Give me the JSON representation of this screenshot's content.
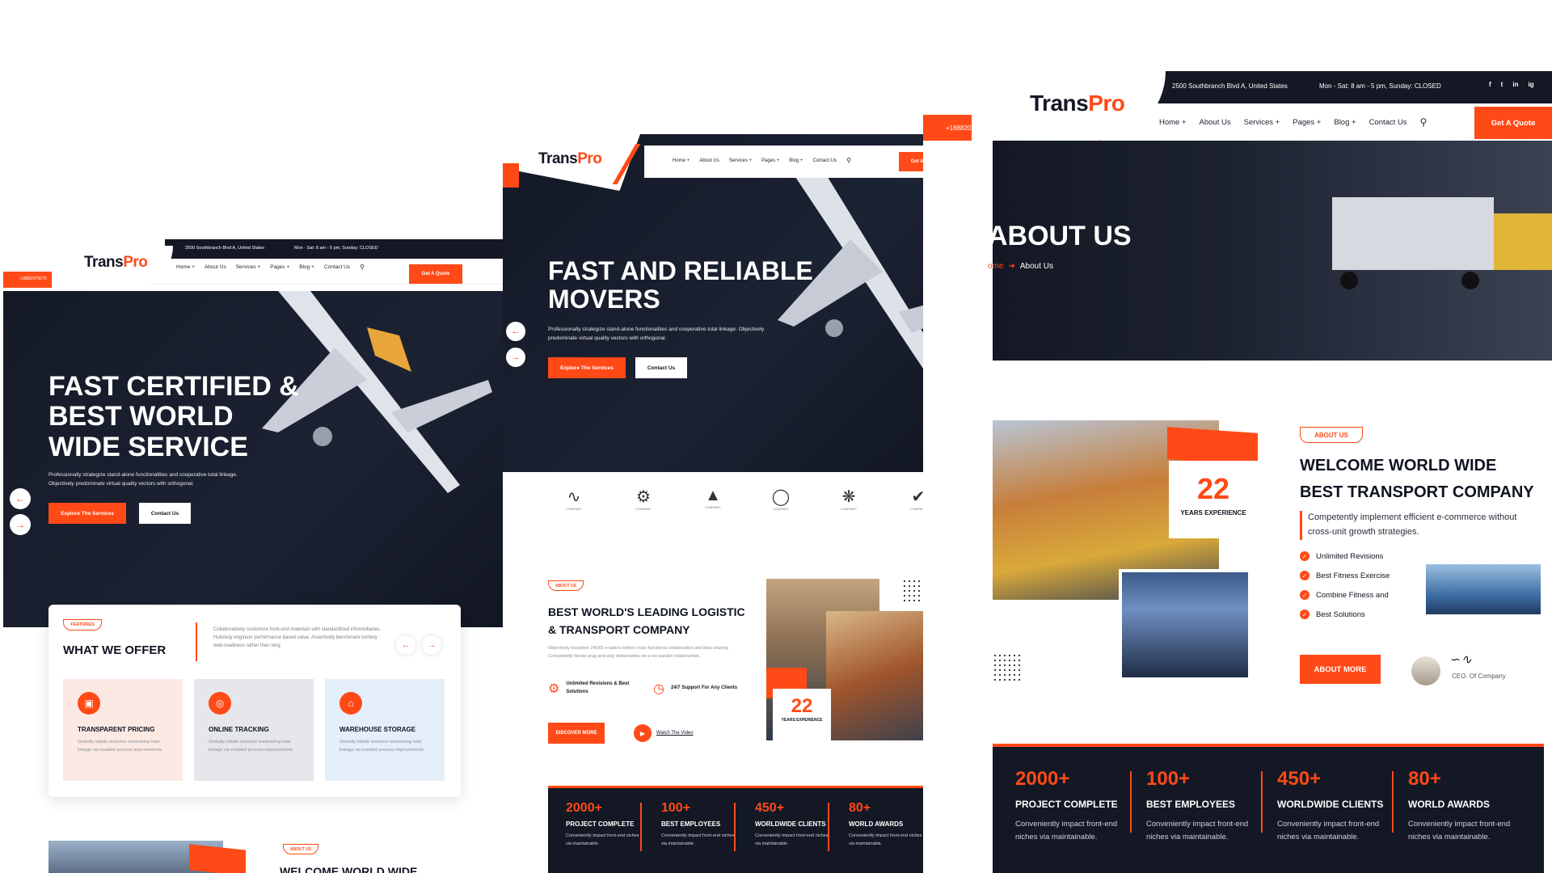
{
  "brand": {
    "logo_trans": "Trans",
    "logo_pro": "Pro",
    "accent": "#ff4a17",
    "dark": "#141824"
  },
  "topbar": {
    "address": "2500 Southbranch Blvd A, United States",
    "hours": "Mon - Sat: 8 am - 5 pm, Sunday: CLOSED",
    "phone": "+18882079275",
    "social": [
      "f",
      "t",
      "in",
      "ig"
    ]
  },
  "nav": {
    "items": [
      "Home +",
      "About Us",
      "Services +",
      "Pages +",
      "Blog +",
      "Contact Us"
    ],
    "quote": "Get A Quote"
  },
  "left": {
    "hero_title_1": "FAST CERTIFIED &",
    "hero_title_2": "BEST WORLD",
    "hero_title_3": "WIDE SERVICE",
    "hero_text_1": "Professionally strategize stand-alone functionalities and cooperative total linkage.",
    "hero_text_2": "Objectively predominate virtual quality vectors with orthogonal.",
    "explore": "Explore The Services",
    "contact": "Contact Us",
    "features_tag": "FEATURES",
    "offer_title": "WHAT WE OFFER",
    "offer_desc": "Collaboratively customize front-end materials with standardized infomediaries. Holisticly engineer performance based value. Assertively benchmark turnkey web-readiness rather than long",
    "cards": [
      {
        "title": "TRANSPARENT PRICING",
        "text": "Globally initiate resource maximizing total linkage via enabled process improvements."
      },
      {
        "title": "ONLINE TRACKING",
        "text": "Globally initiate resource maximizing total linkage via enabled process improvements."
      },
      {
        "title": "WAREHOUSE STORAGE",
        "text": "Globally initiate resource maximizing total linkage via enabled process improvements."
      }
    ],
    "about_tag": "ABOUT US",
    "welcome_partial": "WELCOME WORLD WIDE"
  },
  "middle": {
    "hero_title_1": "FAST AND RELIABLE",
    "hero_title_2": "MOVERS",
    "hero_text_1": "Professionally strategize stand-alone functionalities and cooperative total linkage. Objectively",
    "hero_text_2": "predominate virtual quality vectors with orthogonal.",
    "explore": "Explore The Services",
    "contact": "Contact Us",
    "partner_label": "COMPANY",
    "about_tag": "ABOUT US",
    "about_title_1": "BEST WORLD'S LEADING LOGISTIC",
    "about_title_2": "& TRANSPORT COMPANY",
    "about_text": "Objectively transition 24/365 e-tailers before cross functional collaboration and idea-sharing. Competently iterate plug-and-play deliverables vis-a-vis parallel relationships.",
    "feature_1": "Unlimited Revisions & Best Solutions",
    "feature_2": "24/7 Support For Any Clients",
    "discover": "DISCOVER MORE",
    "watch": "Watch The Video",
    "years": "22",
    "years_label": "YEARS EXPERIENCE"
  },
  "right": {
    "page_title": "ABOUT US",
    "crumb_home": "ome",
    "crumb_current": "About Us",
    "tag": "ABOUT US",
    "title_1": "WELCOME WORLD WIDE",
    "title_2": "BEST TRANSPORT COMPANY",
    "lead": "Competently implement efficient e-commerce without cross-unit growth strategies.",
    "bullets": [
      "Unlimited Revisions",
      "Best Fitness Exercise",
      "Combine Fitness and",
      "Best Solutions"
    ],
    "about_more": "ABOUT MORE",
    "ceo_label": "CEO. Of Company",
    "years": "22",
    "years_label": "YEARS EXPERIENCE"
  },
  "stats": [
    {
      "num": "2000+",
      "label": "PROJECT COMPLETE",
      "desc": "Conveniently impact front-end niches via maintainable."
    },
    {
      "num": "100+",
      "label": "BEST EMPLOYEES",
      "desc": "Conveniently impact front-end niches via maintainable."
    },
    {
      "num": "450+",
      "label": "WORLDWIDE CLIENTS",
      "desc": "Conveniently impact front-end niches via maintainable."
    },
    {
      "num": "80+",
      "label": "WORLD AWARDS",
      "desc": "Conveniently impact front-end niches via maintainable."
    }
  ]
}
